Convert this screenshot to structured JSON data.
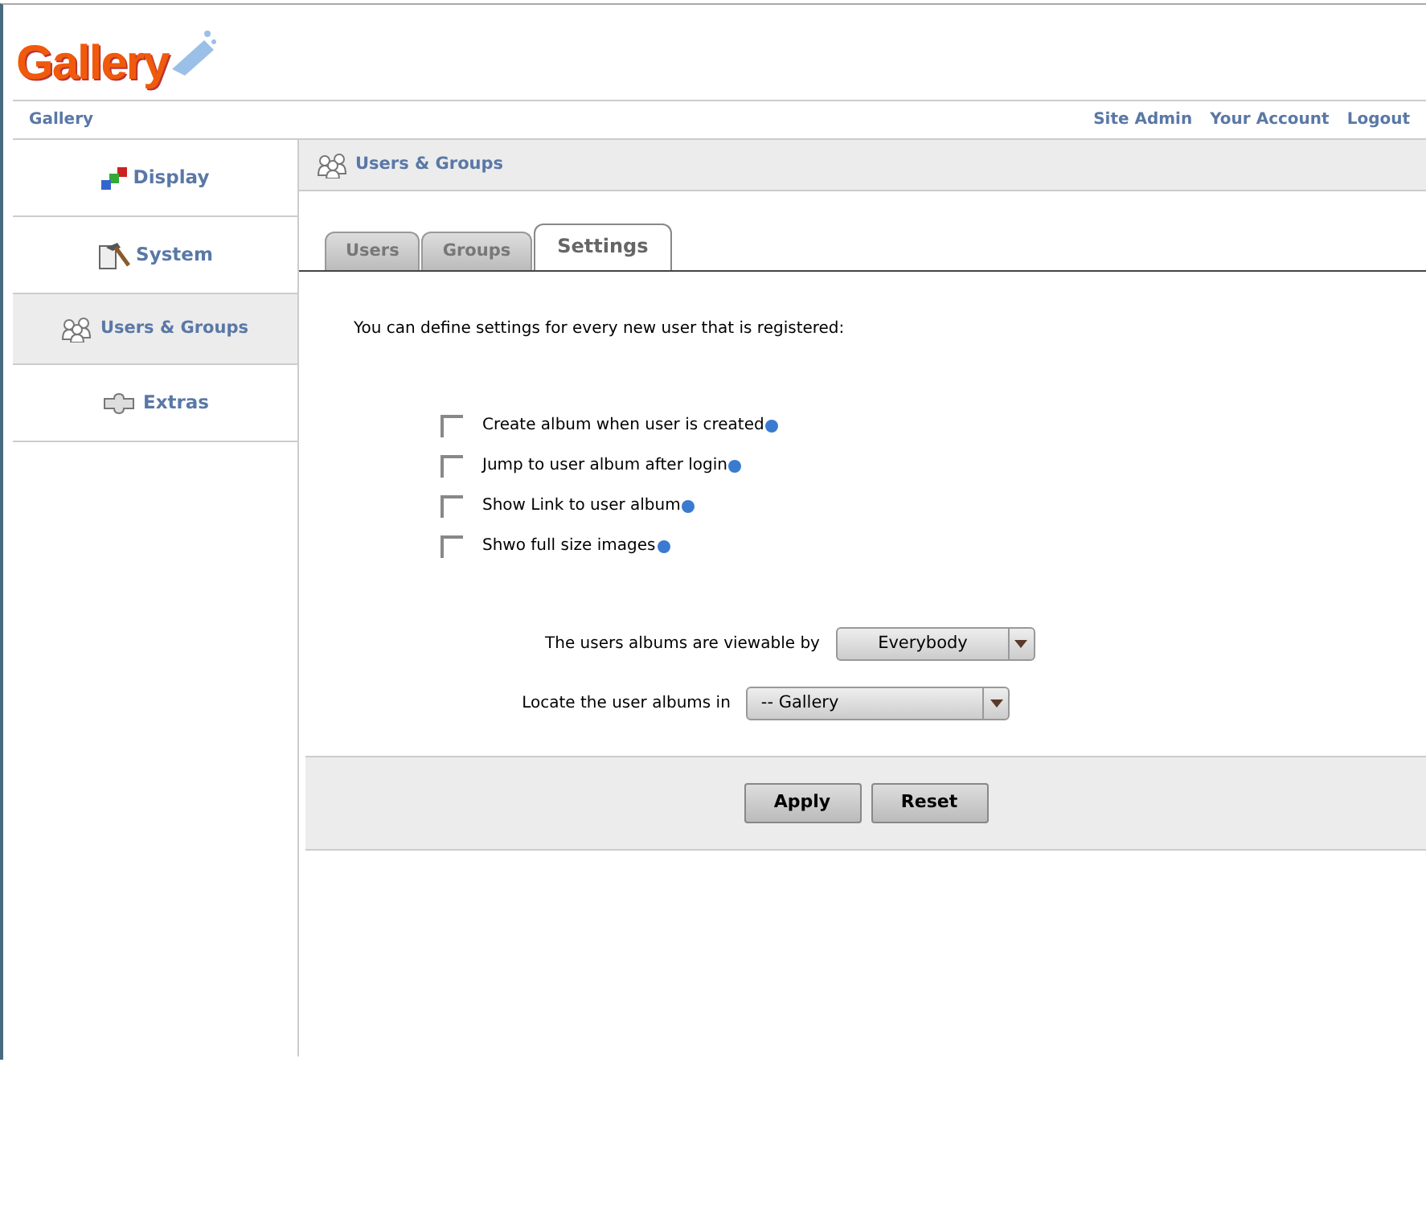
{
  "logo": {
    "text": "Gallery"
  },
  "breadcrumb": "Gallery",
  "top_links": [
    "Site Admin",
    "Your Account",
    "Logout"
  ],
  "sidebar": {
    "items": [
      {
        "label": "Display",
        "kind": "display",
        "selected": false
      },
      {
        "label": "System",
        "kind": "system",
        "selected": false
      },
      {
        "label": "Users & Groups",
        "kind": "users",
        "selected": true
      },
      {
        "label": "Extras",
        "kind": "extras",
        "selected": false
      }
    ]
  },
  "section_title": "Users & Groups",
  "tabs": [
    {
      "label": "Users",
      "selected": false
    },
    {
      "label": "Groups",
      "selected": false
    },
    {
      "label": "Settings",
      "selected": true
    }
  ],
  "intro": "You can define settings for every new user that is registered:",
  "options": [
    {
      "label": "Create album when user is created",
      "checked": false
    },
    {
      "label": "Jump to user album after login",
      "checked": false
    },
    {
      "label": "Show Link to user album",
      "checked": false
    },
    {
      "label": "Shwo full size images",
      "checked": false
    }
  ],
  "selects": [
    {
      "label": "The users albums are viewable by",
      "value": "Everybody"
    },
    {
      "label": "Locate the user albums in",
      "value": "-- Gallery"
    }
  ],
  "buttons": [
    "Apply",
    "Reset"
  ]
}
